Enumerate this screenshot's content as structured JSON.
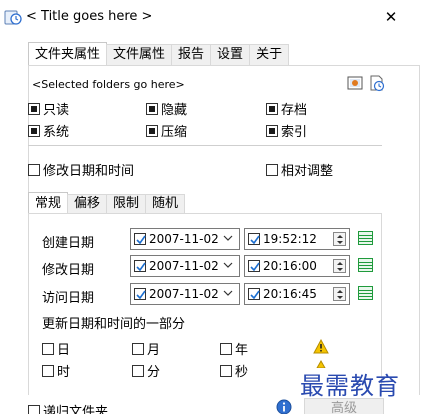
{
  "window": {
    "title": "< Title goes here >",
    "close": "✕"
  },
  "main_tabs": [
    "文件夹属性",
    "文件属性",
    "报告",
    "设置",
    "关于"
  ],
  "folders_label": "<Selected folders go here>",
  "attributes": {
    "readonly": "只读",
    "hidden": "隐藏",
    "archive": "存档",
    "system": "系统",
    "compressed": "压缩",
    "indexed": "索引"
  },
  "modify_datetime": "修改日期和时间",
  "relative_adjust": "相对调整",
  "sub_tabs": [
    "常规",
    "偏移",
    "限制",
    "随机"
  ],
  "rows": [
    {
      "label": "创建日期",
      "date": "2007-11-02",
      "time": "19:52:12"
    },
    {
      "label": "修改日期",
      "date": "2007-11-02",
      "time": "20:16:00"
    },
    {
      "label": "访问日期",
      "date": "2007-11-02",
      "time": "20:16:45"
    }
  ],
  "update_section": "更新日期和时间的一部分",
  "parts": {
    "day": "日",
    "month": "月",
    "year": "年",
    "hour": "时",
    "minute": "分",
    "second": "秒"
  },
  "recursive": "递归文件夹",
  "advanced": "高级",
  "watermark": "最需教育",
  "colors": {
    "accent_blue": "#1c6fd1",
    "grid_green": "#1f9a3c",
    "warn_yellow": "#f5c400",
    "disabled_text": "#9a9a9a"
  }
}
